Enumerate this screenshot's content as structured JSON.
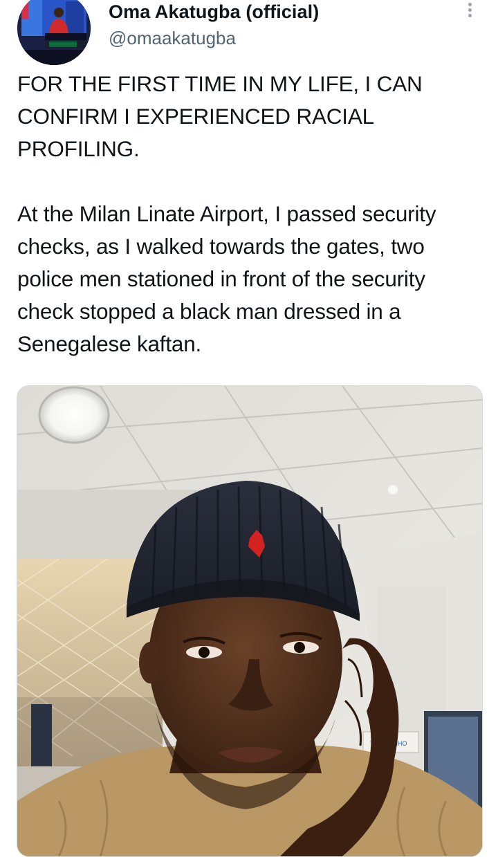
{
  "tweet": {
    "author": {
      "display_name": "Oma Akatugba (official)",
      "handle": "@omaakatugba",
      "avatar_icon": "profile-photo"
    },
    "text": {
      "paragraph_1": "FOR THE FIRST TIME IN MY LIFE, I CAN CONFIRM I EXPERIENCED RACIAL PROFILING.",
      "paragraph_2": "At the Milan Linate Airport, I passed security checks, as I walked towards the gates, two police men stationed in front of the security check stopped a black man dressed in a Senegalese kaftan."
    },
    "more_icon": "more-vertical-icon",
    "media": {
      "type": "photo",
      "store_sign": "TEMAKINHO"
    },
    "colors": {
      "text_primary": "#0f1419",
      "text_secondary": "#536471",
      "border": "#cfd9de"
    }
  }
}
